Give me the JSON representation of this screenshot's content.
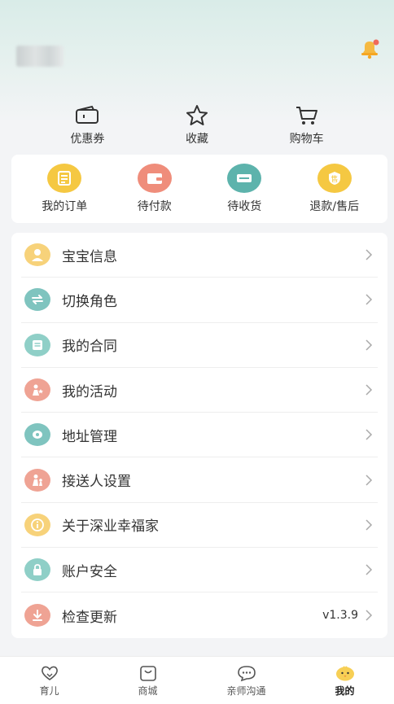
{
  "quick_actions": [
    {
      "label": "优惠券",
      "icon": "coupon-icon"
    },
    {
      "label": "收藏",
      "icon": "star-icon"
    },
    {
      "label": "购物车",
      "icon": "cart-icon"
    }
  ],
  "orders": [
    {
      "label": "我的订单",
      "icon": "order-list-icon",
      "color": "#f5c842"
    },
    {
      "label": "待付款",
      "icon": "wallet-icon",
      "color": "#ef8d7b"
    },
    {
      "label": "待收货",
      "icon": "delivery-icon",
      "color": "#5db3ac"
    },
    {
      "label": "退款/售后",
      "icon": "after-sale-icon",
      "color": "#f5c842"
    }
  ],
  "menu": [
    {
      "label": "宝宝信息",
      "icon": "baby-icon",
      "color": "#f7d27a"
    },
    {
      "label": "切换角色",
      "icon": "switch-icon",
      "color": "#7fc4bf"
    },
    {
      "label": "我的合同",
      "icon": "contract-icon",
      "color": "#8fcfc7"
    },
    {
      "label": "我的活动",
      "icon": "activity-icon",
      "color": "#efa394"
    },
    {
      "label": "地址管理",
      "icon": "location-icon",
      "color": "#7fc4bf"
    },
    {
      "label": "接送人设置",
      "icon": "pickup-person-icon",
      "color": "#efa394"
    },
    {
      "label": "关于深业幸福家",
      "icon": "info-icon",
      "color": "#f7d27a"
    },
    {
      "label": "账户安全",
      "icon": "lock-icon",
      "color": "#8fcfc7"
    },
    {
      "label": "检查更新",
      "icon": "download-icon",
      "color": "#efa394",
      "value": "v1.3.9"
    }
  ],
  "tabs": [
    {
      "label": "育儿",
      "icon": "heart-hand-icon",
      "active": false
    },
    {
      "label": "商城",
      "icon": "shop-bag-icon",
      "active": false
    },
    {
      "label": "亲师沟通",
      "icon": "chat-icon",
      "active": false
    },
    {
      "label": "我的",
      "icon": "chick-face-icon",
      "active": true
    }
  ],
  "colors": {
    "accent": "#f5c842",
    "teal": "#5db3ac",
    "coral": "#ef8d7b",
    "bell": "#f5b942",
    "badge": "#f06a5a"
  }
}
